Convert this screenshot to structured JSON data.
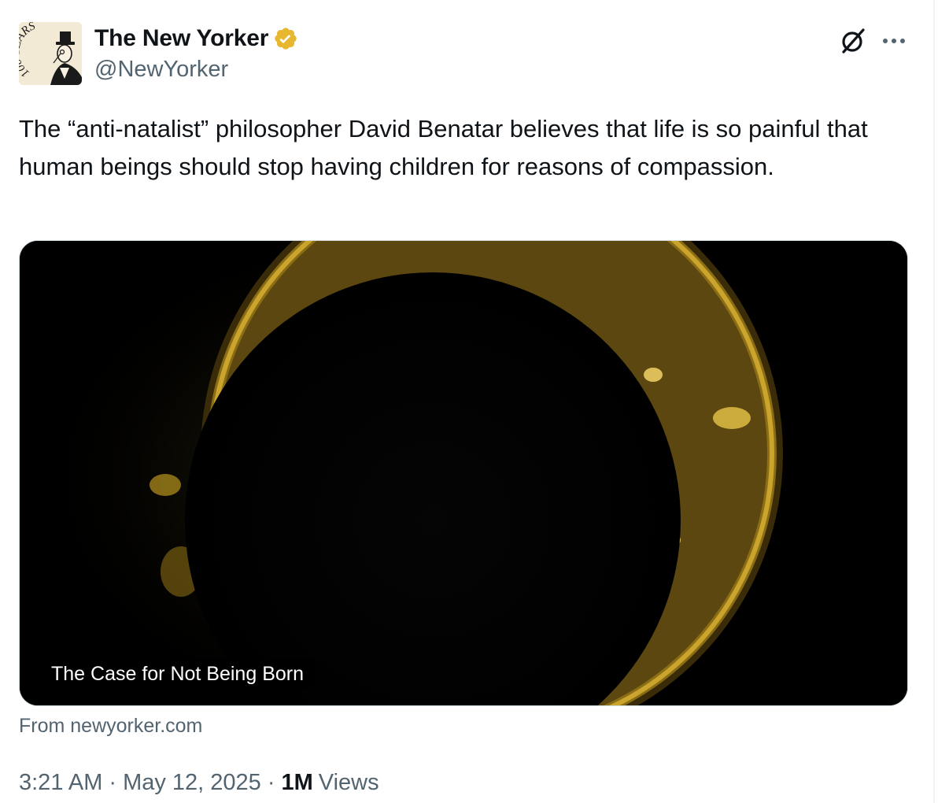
{
  "author": {
    "display_name": "The New Yorker",
    "handle": "@NewYorker",
    "avatar_text": "100 YEARS",
    "verified_icon": "verified-gold-badge-icon"
  },
  "actions": {
    "grok_icon": "grok-slashed-circle-icon",
    "more_icon": "more-dots-icon"
  },
  "tweet": {
    "text": "The “anti-natalist” philosopher David Benatar believes that life is so painful that human beings should stop having children for reasons of compassion."
  },
  "card": {
    "title": "The Case for Not Being Born",
    "source": "From newyorker.com"
  },
  "meta": {
    "time": "3:21 AM",
    "separator": "·",
    "date": "May 12, 2025",
    "views_count": "1M",
    "views_label": "Views"
  },
  "colors": {
    "text_primary": "#0f1419",
    "text_secondary": "#536471",
    "verified_gold": "#e8b730",
    "card_border": "#cfd9de",
    "corona": "#c9a227"
  }
}
